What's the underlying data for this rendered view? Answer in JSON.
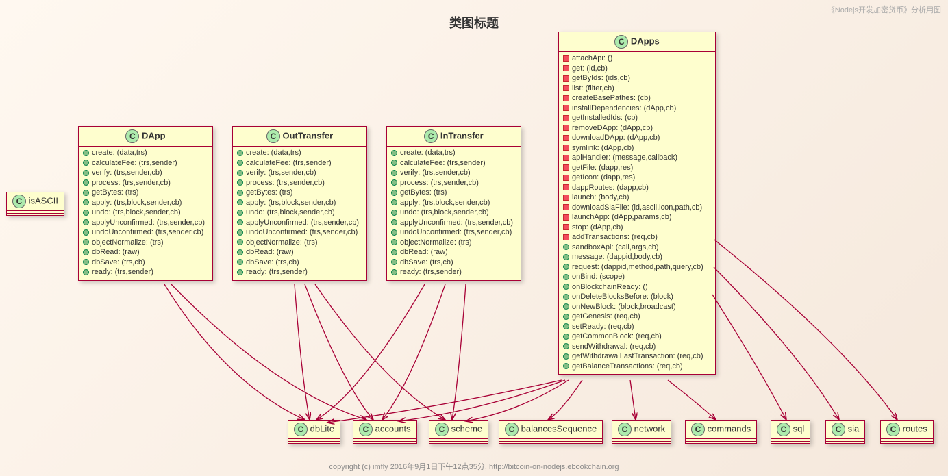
{
  "title": "类图标题",
  "watermark": "《Nodejs开发加密货币》分析用图",
  "footer": "copyright (c) imfly 2016年9月1日下午12点35分,   http://bitcoin-on-nodejs.ebookchain.org",
  "classes": {
    "isASCII": {
      "name": "isASCII",
      "members": []
    },
    "DApp": {
      "name": "DApp",
      "members": [
        {
          "v": "pub",
          "sig": "create: (data,trs)"
        },
        {
          "v": "pub",
          "sig": "calculateFee: (trs,sender)"
        },
        {
          "v": "pub",
          "sig": "verify: (trs,sender,cb)"
        },
        {
          "v": "pub",
          "sig": "process: (trs,sender,cb)"
        },
        {
          "v": "pub",
          "sig": "getBytes: (trs)"
        },
        {
          "v": "pub",
          "sig": "apply: (trs,block,sender,cb)"
        },
        {
          "v": "pub",
          "sig": "undo: (trs,block,sender,cb)"
        },
        {
          "v": "pub",
          "sig": "applyUnconfirmed: (trs,sender,cb)"
        },
        {
          "v": "pub",
          "sig": "undoUnconfirmed: (trs,sender,cb)"
        },
        {
          "v": "pub",
          "sig": "objectNormalize: (trs)"
        },
        {
          "v": "pub",
          "sig": "dbRead: (raw)"
        },
        {
          "v": "pub",
          "sig": "dbSave: (trs,cb)"
        },
        {
          "v": "pub",
          "sig": "ready: (trs,sender)"
        }
      ]
    },
    "OutTransfer": {
      "name": "OutTransfer",
      "members": [
        {
          "v": "pub",
          "sig": "create: (data,trs)"
        },
        {
          "v": "pub",
          "sig": "calculateFee: (trs,sender)"
        },
        {
          "v": "pub",
          "sig": "verify: (trs,sender,cb)"
        },
        {
          "v": "pub",
          "sig": "process: (trs,sender,cb)"
        },
        {
          "v": "pub",
          "sig": "getBytes: (trs)"
        },
        {
          "v": "pub",
          "sig": "apply: (trs,block,sender,cb)"
        },
        {
          "v": "pub",
          "sig": "undo: (trs,block,sender,cb)"
        },
        {
          "v": "pub",
          "sig": "applyUnconfirmed: (trs,sender,cb)"
        },
        {
          "v": "pub",
          "sig": "undoUnconfirmed: (trs,sender,cb)"
        },
        {
          "v": "pub",
          "sig": "objectNormalize: (trs)"
        },
        {
          "v": "pub",
          "sig": "dbRead: (raw)"
        },
        {
          "v": "pub",
          "sig": "dbSave: (trs,cb)"
        },
        {
          "v": "pub",
          "sig": "ready: (trs,sender)"
        }
      ]
    },
    "InTransfer": {
      "name": "InTransfer",
      "members": [
        {
          "v": "pub",
          "sig": "create: (data,trs)"
        },
        {
          "v": "pub",
          "sig": "calculateFee: (trs,sender)"
        },
        {
          "v": "pub",
          "sig": "verify: (trs,sender,cb)"
        },
        {
          "v": "pub",
          "sig": "process: (trs,sender,cb)"
        },
        {
          "v": "pub",
          "sig": "getBytes: (trs)"
        },
        {
          "v": "pub",
          "sig": "apply: (trs,block,sender,cb)"
        },
        {
          "v": "pub",
          "sig": "undo: (trs,block,sender,cb)"
        },
        {
          "v": "pub",
          "sig": "applyUnconfirmed: (trs,sender,cb)"
        },
        {
          "v": "pub",
          "sig": "undoUnconfirmed: (trs,sender,cb)"
        },
        {
          "v": "pub",
          "sig": "objectNormalize: (trs)"
        },
        {
          "v": "pub",
          "sig": "dbRead: (raw)"
        },
        {
          "v": "pub",
          "sig": "dbSave: (trs,cb)"
        },
        {
          "v": "pub",
          "sig": "ready: (trs,sender)"
        }
      ]
    },
    "DApps": {
      "name": "DApps",
      "members": [
        {
          "v": "priv",
          "sig": "attachApi: ()"
        },
        {
          "v": "priv",
          "sig": "get: (id,cb)"
        },
        {
          "v": "priv",
          "sig": "getByIds: (ids,cb)"
        },
        {
          "v": "priv",
          "sig": "list: (filter,cb)"
        },
        {
          "v": "priv",
          "sig": "createBasePathes: (cb)"
        },
        {
          "v": "priv",
          "sig": "installDependencies: (dApp,cb)"
        },
        {
          "v": "priv",
          "sig": "getInstalledIds: (cb)"
        },
        {
          "v": "priv",
          "sig": "removeDApp: (dApp,cb)"
        },
        {
          "v": "priv",
          "sig": "downloadDApp: (dApp,cb)"
        },
        {
          "v": "priv",
          "sig": "symlink: (dApp,cb)"
        },
        {
          "v": "priv",
          "sig": "apiHandler: (message,callback)"
        },
        {
          "v": "priv",
          "sig": "getFile: (dapp,res)"
        },
        {
          "v": "priv",
          "sig": "getIcon: (dapp,res)"
        },
        {
          "v": "priv",
          "sig": "dappRoutes: (dapp,cb)"
        },
        {
          "v": "priv",
          "sig": "launch: (body,cb)"
        },
        {
          "v": "priv",
          "sig": "downloadSiaFile: (id,ascii,icon,path,cb)"
        },
        {
          "v": "priv",
          "sig": "launchApp: (dApp,params,cb)"
        },
        {
          "v": "priv",
          "sig": "stop: (dApp,cb)"
        },
        {
          "v": "priv",
          "sig": "addTransactions: (req,cb)"
        },
        {
          "v": "pub",
          "sig": "sandboxApi: (call,args,cb)"
        },
        {
          "v": "pub",
          "sig": "message: (dappid,body,cb)"
        },
        {
          "v": "pub",
          "sig": "request: (dappid,method,path,query,cb)"
        },
        {
          "v": "pub",
          "sig": "onBind: (scope)"
        },
        {
          "v": "pub",
          "sig": "onBlockchainReady: ()"
        },
        {
          "v": "pub",
          "sig": "onDeleteBlocksBefore: (block)"
        },
        {
          "v": "pub",
          "sig": "onNewBlock: (block,broadcast)"
        },
        {
          "v": "pub",
          "sig": "getGenesis: (req,cb)"
        },
        {
          "v": "pub",
          "sig": "setReady: (req,cb)"
        },
        {
          "v": "pub",
          "sig": "getCommonBlock: (req,cb)"
        },
        {
          "v": "pub",
          "sig": "sendWithdrawal: (req,cb)"
        },
        {
          "v": "pub",
          "sig": "getWithdrawalLastTransaction: (req,cb)"
        },
        {
          "v": "pub",
          "sig": "getBalanceTransactions: (req,cb)"
        }
      ]
    },
    "dbLite": {
      "name": "dbLite"
    },
    "accounts": {
      "name": "accounts"
    },
    "scheme": {
      "name": "scheme"
    },
    "balancesSequence": {
      "name": "balancesSequence"
    },
    "network": {
      "name": "network"
    },
    "commands": {
      "name": "commands"
    },
    "sql": {
      "name": "sql"
    },
    "sia": {
      "name": "sia"
    },
    "routes": {
      "name": "routes"
    }
  }
}
